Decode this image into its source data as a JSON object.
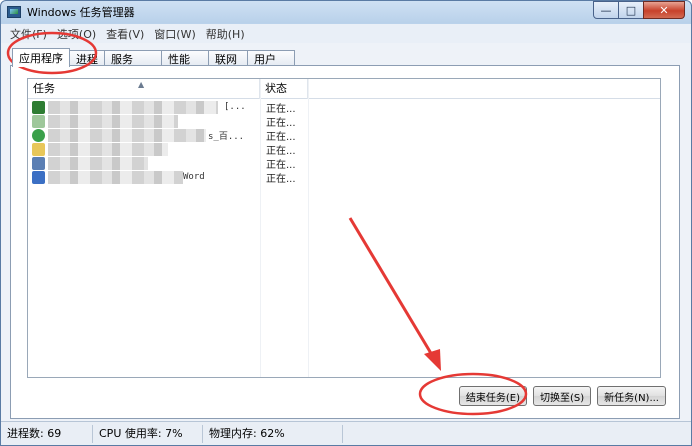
{
  "window": {
    "title": "Windows 任务管理器",
    "controls": {
      "minimize": "—",
      "maximize": "□",
      "close": "✕"
    }
  },
  "menu": [
    "文件(F)",
    "选项(O)",
    "查看(V)",
    "窗口(W)",
    "帮助(H)"
  ],
  "tabs": [
    "应用程序",
    "进程",
    "服务",
    "性能",
    "联网",
    "用户"
  ],
  "active_tab": "应用程序",
  "list": {
    "columns": {
      "task": "任务",
      "status": "状态"
    },
    "rows": [
      {
        "icon": "excel-icon",
        "icon_color": "#2e7d32",
        "suffix": "[...",
        "status": "正在..."
      },
      {
        "icon": "window-icon",
        "icon_color": "#9ec79a",
        "suffix": "",
        "status": "正在..."
      },
      {
        "icon": "ie-icon",
        "icon_color": "#3aa04a",
        "suffix": "s_百...",
        "status": "正在..."
      },
      {
        "icon": "folder-icon",
        "icon_color": "#e8c75a",
        "suffix": "",
        "status": "正在..."
      },
      {
        "icon": "app-icon",
        "icon_color": "#5b7fb4",
        "suffix": "",
        "status": "正在..."
      },
      {
        "icon": "word-icon",
        "icon_color": "#3b6fc4",
        "suffix": "Word",
        "status": "正在..."
      }
    ]
  },
  "buttons": {
    "end_task": "结束任务(E)",
    "switch_to": "切换至(S)",
    "new_task": "新任务(N)..."
  },
  "statusbar": {
    "processes": "进程数: 69",
    "cpu": "CPU 使用率: 7%",
    "memory": "物理内存: 62%"
  },
  "annotation_color": "#e53935"
}
